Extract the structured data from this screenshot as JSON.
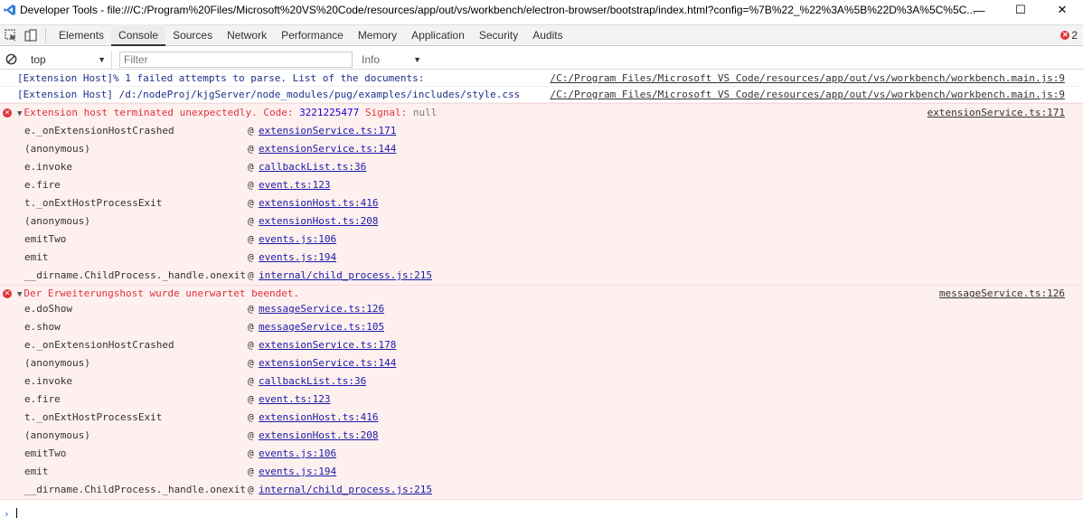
{
  "window": {
    "title": "Developer Tools - file:///C:/Program%20Files/Microsoft%20VS%20Code/resources/app/out/vs/workbench/electron-browser/bootstrap/index.html?config=%7B%22_%22%3A%5B%22D%3A%5C%5C...",
    "minimize": "—",
    "maximize": "☐",
    "close": "✕"
  },
  "tabs": [
    "Elements",
    "Console",
    "Sources",
    "Network",
    "Performance",
    "Memory",
    "Application",
    "Security",
    "Audits"
  ],
  "active_tab": "Console",
  "error_count": "2",
  "console_toolbar": {
    "context": "top",
    "filter_placeholder": "Filter",
    "level": "Info"
  },
  "messages": {
    "info1": {
      "text": "[Extension Host]% 1 failed attempts to parse. List of the documents:",
      "source": "/C:/Program Files/Microsoft VS Code/resources/app/out/vs/workbench/workbench.main.js:9"
    },
    "info2": {
      "text": "[Extension Host] /d:/nodeProj/kjgServer/node_modules/pug/examples/includes/style.css",
      "source": "/C:/Program Files/Microsoft VS Code/resources/app/out/vs/workbench/workbench.main.js:9"
    },
    "error1": {
      "text": "Extension host terminated unexpectedly. Code: ",
      "code": "3221225477",
      "signal_label": " Signal: ",
      "signal": "null",
      "source": "extensionService.ts:171",
      "frames": [
        {
          "fn": "e._onExtensionHostCrashed",
          "loc": "extensionService.ts:171"
        },
        {
          "fn": "(anonymous)",
          "loc": "extensionService.ts:144"
        },
        {
          "fn": "e.invoke",
          "loc": "callbackList.ts:36"
        },
        {
          "fn": "e.fire",
          "loc": "event.ts:123"
        },
        {
          "fn": "t._onExtHostProcessExit",
          "loc": "extensionHost.ts:416"
        },
        {
          "fn": "(anonymous)",
          "loc": "extensionHost.ts:208"
        },
        {
          "fn": "emitTwo",
          "loc": "events.js:106"
        },
        {
          "fn": "emit",
          "loc": "events.js:194"
        },
        {
          "fn": "__dirname.ChildProcess._handle.onexit",
          "loc": "internal/child_process.js:215"
        }
      ]
    },
    "error2": {
      "text": "Der Erweiterungshost wurde unerwartet beendet.",
      "source": "messageService.ts:126",
      "frames": [
        {
          "fn": "e.doShow",
          "loc": "messageService.ts:126"
        },
        {
          "fn": "e.show",
          "loc": "messageService.ts:105"
        },
        {
          "fn": "e._onExtensionHostCrashed",
          "loc": "extensionService.ts:178"
        },
        {
          "fn": "(anonymous)",
          "loc": "extensionService.ts:144"
        },
        {
          "fn": "e.invoke",
          "loc": "callbackList.ts:36"
        },
        {
          "fn": "e.fire",
          "loc": "event.ts:123"
        },
        {
          "fn": "t._onExtHostProcessExit",
          "loc": "extensionHost.ts:416"
        },
        {
          "fn": "(anonymous)",
          "loc": "extensionHost.ts:208"
        },
        {
          "fn": "emitTwo",
          "loc": "events.js:106"
        },
        {
          "fn": "emit",
          "loc": "events.js:194"
        },
        {
          "fn": "__dirname.ChildProcess._handle.onexit",
          "loc": "internal/child_process.js:215"
        }
      ]
    }
  },
  "at_symbol": "@",
  "colors": {
    "error": "#e0323a",
    "error_bg": "#fff0f0",
    "info_text": "#1f2f8a",
    "link": "#1a1aa6",
    "number": "#1c00cf",
    "accent": "#2a6fe1"
  }
}
